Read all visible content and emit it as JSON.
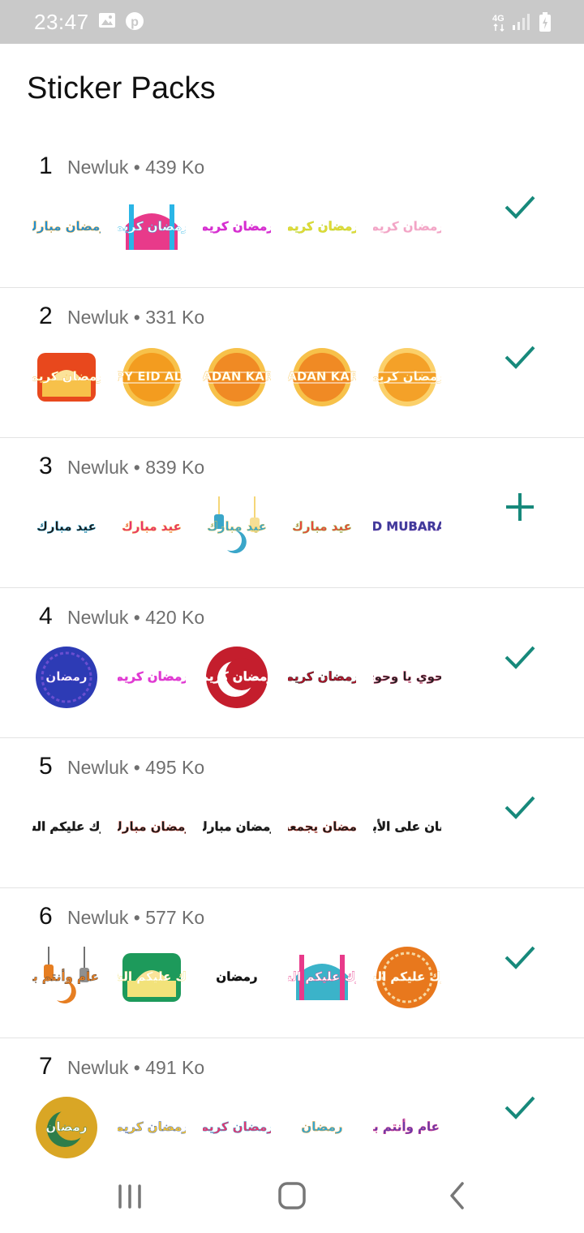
{
  "status_bar": {
    "time": "23:47",
    "left_icons": [
      "image-icon",
      "pinterest-icon"
    ],
    "right_icons": [
      "4g-icon",
      "signal-icon",
      "battery-icon"
    ],
    "network_label": "4G"
  },
  "page_title": "Sticker Packs",
  "colors": {
    "accent": "#17897b",
    "status_bar": "#c9c9c9"
  },
  "packs": [
    {
      "number": "1",
      "meta": "Newluk • 439 Ko",
      "action": "added-check-icon",
      "stickers": [
        {
          "text": "رمضان مبارك",
          "c1": "#1f8fd6",
          "c2": "#f5a623",
          "shape": "text"
        },
        {
          "text": "رمضان كريم",
          "c1": "#e83a8a",
          "c2": "#2ab5e6",
          "shape": "mosque"
        },
        {
          "text": "رمضان كريم",
          "c1": "#d62fd0",
          "c2": "#d62fd0",
          "shape": "text"
        },
        {
          "text": "رمضان كريم",
          "c1": "#e4d735",
          "c2": "#b7d934",
          "shape": "text"
        },
        {
          "text": "رمضان كريم",
          "c1": "#f2a3c5",
          "c2": "#f7c3d8",
          "shape": "text"
        }
      ]
    },
    {
      "number": "2",
      "meta": "Newluk • 331 Ko",
      "action": "added-check-icon",
      "stickers": [
        {
          "text": "رمضان كريم",
          "c1": "#e8481d",
          "c2": "#f7c14a",
          "shape": "banner"
        },
        {
          "text": "HAPPY EID AL FITR",
          "c1": "#f39c1f",
          "c2": "#f7c14a",
          "shape": "badge"
        },
        {
          "text": "RAMADAN KAREEM",
          "c1": "#f08a24",
          "c2": "#f7c14a",
          "shape": "badge"
        },
        {
          "text": "RAMADAN KAREEM",
          "c1": "#f08a24",
          "c2": "#f7c14a",
          "shape": "badge"
        },
        {
          "text": "رمضان كريم",
          "c1": "#f4a128",
          "c2": "#fbd06a",
          "shape": "badge"
        }
      ]
    },
    {
      "number": "3",
      "meta": "Newluk • 839 Ko",
      "action": "add-plus-icon",
      "stickers": [
        {
          "text": "عيد مبارك",
          "c1": "#1c1c1c",
          "c2": "#27a8d8",
          "shape": "text"
        },
        {
          "text": "عيد مبارك",
          "c1": "#e8356d",
          "c2": "#f39c1f",
          "shape": "text"
        },
        {
          "text": "عيد مبارك",
          "c1": "#3aa6c9",
          "c2": "#f2c94c",
          "shape": "lantern"
        },
        {
          "text": "عيد مبارك",
          "c1": "#e84a3c",
          "c2": "#8bc34a",
          "shape": "text"
        },
        {
          "text": "EID MUBARAK",
          "c1": "#3b3a98",
          "c2": "#7b4fb7",
          "shape": "text"
        }
      ]
    },
    {
      "number": "4",
      "meta": "Newluk • 420 Ko",
      "action": "added-check-icon",
      "stickers": [
        {
          "text": "رمضان",
          "c1": "#2d3bb5",
          "c2": "#6a4fd0",
          "shape": "circle"
        },
        {
          "text": "رمضان كريم",
          "c1": "#e03ad2",
          "c2": "#e03ad2",
          "shape": "text"
        },
        {
          "text": "رمضان كريم",
          "c1": "#c41e2d",
          "c2": "#ffffff",
          "shape": "moon"
        },
        {
          "text": "رمضان كريم",
          "c1": "#b4142a",
          "c2": "#1a1a1a",
          "shape": "text"
        },
        {
          "text": "وحوي يا وحوي",
          "c1": "#222222",
          "c2": "#d63a6a",
          "shape": "text"
        }
      ]
    },
    {
      "number": "5",
      "meta": "Newluk • 495 Ko",
      "action": "added-check-icon",
      "stickers": [
        {
          "text": "مبارك عليكم الشهر",
          "c1": "#1a1a1a",
          "c2": "#1a1a1a",
          "shape": "text"
        },
        {
          "text": "رمضان مبارك",
          "c1": "#1a1a1a",
          "c2": "#c0392b",
          "shape": "text"
        },
        {
          "text": "رمضان مبارك",
          "c1": "#1a1a1a",
          "c2": "#1a1a1a",
          "shape": "text"
        },
        {
          "text": "رمضان يجمعنا",
          "c1": "#1a1a1a",
          "c2": "#c0392b",
          "shape": "text"
        },
        {
          "text": "رمضان على الأبواب",
          "c1": "#1a1a1a",
          "c2": "#1a1a1a",
          "shape": "text"
        }
      ]
    },
    {
      "number": "6",
      "meta": "Newluk • 577 Ko",
      "action": "added-check-icon",
      "stickers": [
        {
          "text": "كل عام وأنتم بخير",
          "c1": "#e67e22",
          "c2": "#444444",
          "shape": "lantern"
        },
        {
          "text": "تبارك عليكم الشهر",
          "c1": "#1d9a5b",
          "c2": "#f2e27a",
          "shape": "banner"
        },
        {
          "text": "رمضان",
          "c1": "#111111",
          "c2": "#111111",
          "shape": "text"
        },
        {
          "text": "مبارك عليكم الشهر",
          "c1": "#3bb3c9",
          "c2": "#e83a8a",
          "shape": "mosque"
        },
        {
          "text": "مبارك عليكم الشهر",
          "c1": "#e8781d",
          "c2": "#f7d9a4",
          "shape": "circle"
        }
      ]
    },
    {
      "number": "7",
      "meta": "Newluk • 491 Ko",
      "action": "added-check-icon",
      "stickers": [
        {
          "text": "رمضان",
          "c1": "#d9a625",
          "c2": "#2e7d4a",
          "shape": "moon"
        },
        {
          "text": "رمضان كريم",
          "c1": "#f4c430",
          "c2": "#2f5fd0",
          "shape": "text"
        },
        {
          "text": "رمضان كريم",
          "c1": "#e8356d",
          "c2": "#2fa8d8",
          "shape": "text"
        },
        {
          "text": "رمضان",
          "c1": "#2fa8d8",
          "c2": "#f39c1f",
          "shape": "text"
        },
        {
          "text": "كل عام وأنتم بخير",
          "c1": "#6a3aa8",
          "c2": "#e83a8a",
          "shape": "text"
        }
      ]
    }
  ],
  "nav_bar": [
    "recent-apps-icon",
    "home-icon",
    "back-icon"
  ]
}
